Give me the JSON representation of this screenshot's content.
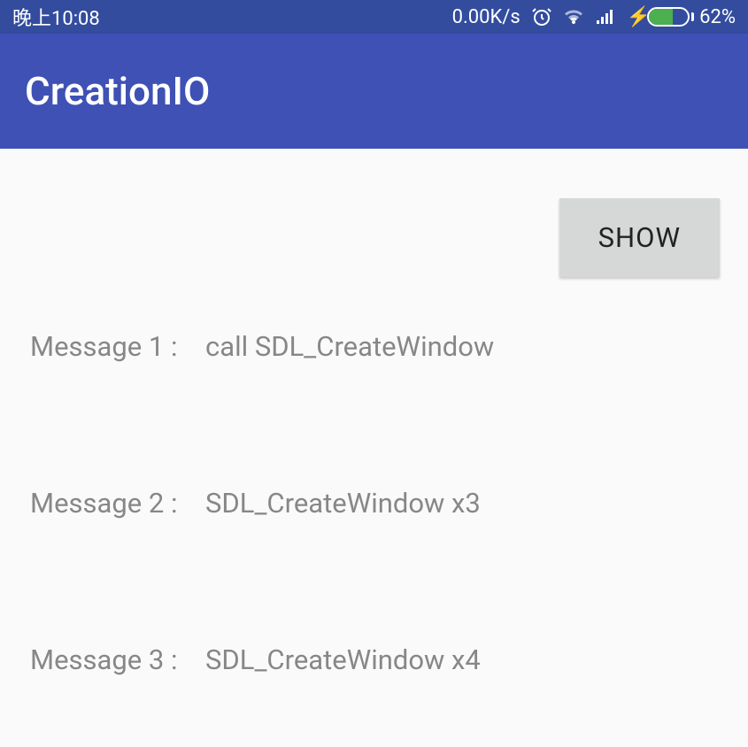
{
  "status": {
    "time": "晚上10:08",
    "netSpeed": "0.00K/s",
    "batteryPct": "62%"
  },
  "appBar": {
    "title": "CreationIO"
  },
  "buttons": {
    "show": "SHOW"
  },
  "messages": [
    {
      "label": "Message 1 :",
      "value": "call SDL_CreateWindow"
    },
    {
      "label": "Message 2 :",
      "value": "SDL_CreateWindow x3"
    },
    {
      "label": "Message 3 :",
      "value": "SDL_CreateWindow x4"
    }
  ]
}
